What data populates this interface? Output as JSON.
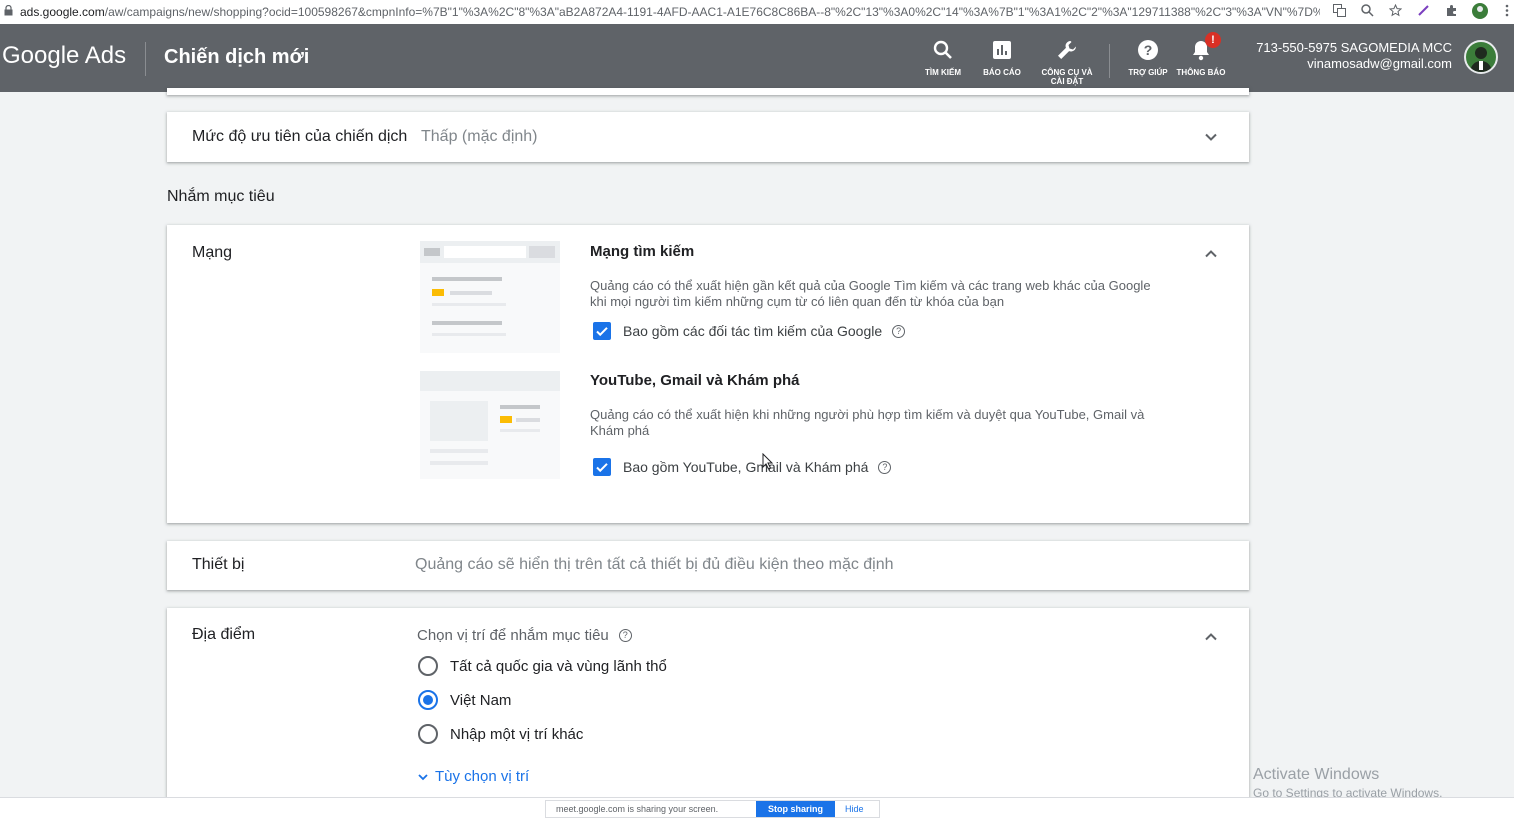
{
  "browser": {
    "url_host": "ads.google.com",
    "url_path": "/aw/campaigns/new/shopping?ocid=100598267&cmpnInfo=%7B\"1\"%3A%2C\"8\"%3A\"aB2A872A4-1191-4AFD-AAC1-A1E76C8C86BA--8\"%2C\"13\"%3A0%2C\"14\"%3A%7B\"1\"%3A1%2C\"2\"%3A\"129711388\"%2C\"3\"%3A\"VN\"%7D%2C\"..."
  },
  "header": {
    "brand": "Google Ads",
    "title": "Chiến dịch mới",
    "nav": [
      {
        "label": "TÌM KIẾM"
      },
      {
        "label": "BÁO CÁO"
      },
      {
        "label": "CÔNG CỤ VÀ CÀI ĐẶT"
      },
      {
        "label": "TRỢ GIÚP"
      },
      {
        "label": "THÔNG BÁO"
      }
    ],
    "notification_badge": "!",
    "account_id": "713-550-5975 SAGOMEDIA MCC",
    "account_email": "vinamosadw@gmail.com"
  },
  "priority": {
    "label": "Mức độ ưu tiên của chiến dịch",
    "value": "Thấp (mặc định)"
  },
  "targeting_heading": "Nhắm mục tiêu",
  "networks": {
    "label": "Mạng",
    "search": {
      "title": "Mạng tìm kiếm",
      "desc": "Quảng cáo có thể xuất hiện gần kết quả của Google Tìm kiếm và các trang web khác của Google khi mọi người tìm kiếm những cụm từ có liên quan đến từ khóa của bạn",
      "checkbox_label": "Bao gồm các đối tác tìm kiếm của Google",
      "checked": true
    },
    "display": {
      "title": "YouTube, Gmail và Khám phá",
      "desc": "Quảng cáo có thể xuất hiện khi những người phù hợp tìm kiếm và duyệt qua YouTube, Gmail và Khám phá",
      "checkbox_label": "Bao gồm YouTube, Gmail và Khám phá",
      "checked": true
    }
  },
  "devices": {
    "label": "Thiết bị",
    "value": "Quảng cáo sẽ hiển thị trên tất cả thiết bị đủ điều kiện theo mặc định"
  },
  "locations": {
    "label": "Địa điểm",
    "prompt": "Chọn vị trí để nhắm mục tiêu",
    "options": [
      {
        "label": "Tất cả quốc gia và vùng lãnh thổ",
        "selected": false
      },
      {
        "label": "Việt Nam",
        "selected": true
      },
      {
        "label": "Nhập một vị trí khác",
        "selected": false
      }
    ],
    "more_link": "Tùy chọn vị trí"
  },
  "watermark": {
    "line1": "Activate Windows",
    "line2": "Go to Settings to activate Windows."
  },
  "share_bar": {
    "message": "meet.google.com is sharing your screen.",
    "stop": "Stop sharing",
    "hide": "Hide"
  },
  "colors": {
    "header_bg": "#5f6368",
    "accent": "#1a73e8",
    "badge": "#d93025"
  }
}
